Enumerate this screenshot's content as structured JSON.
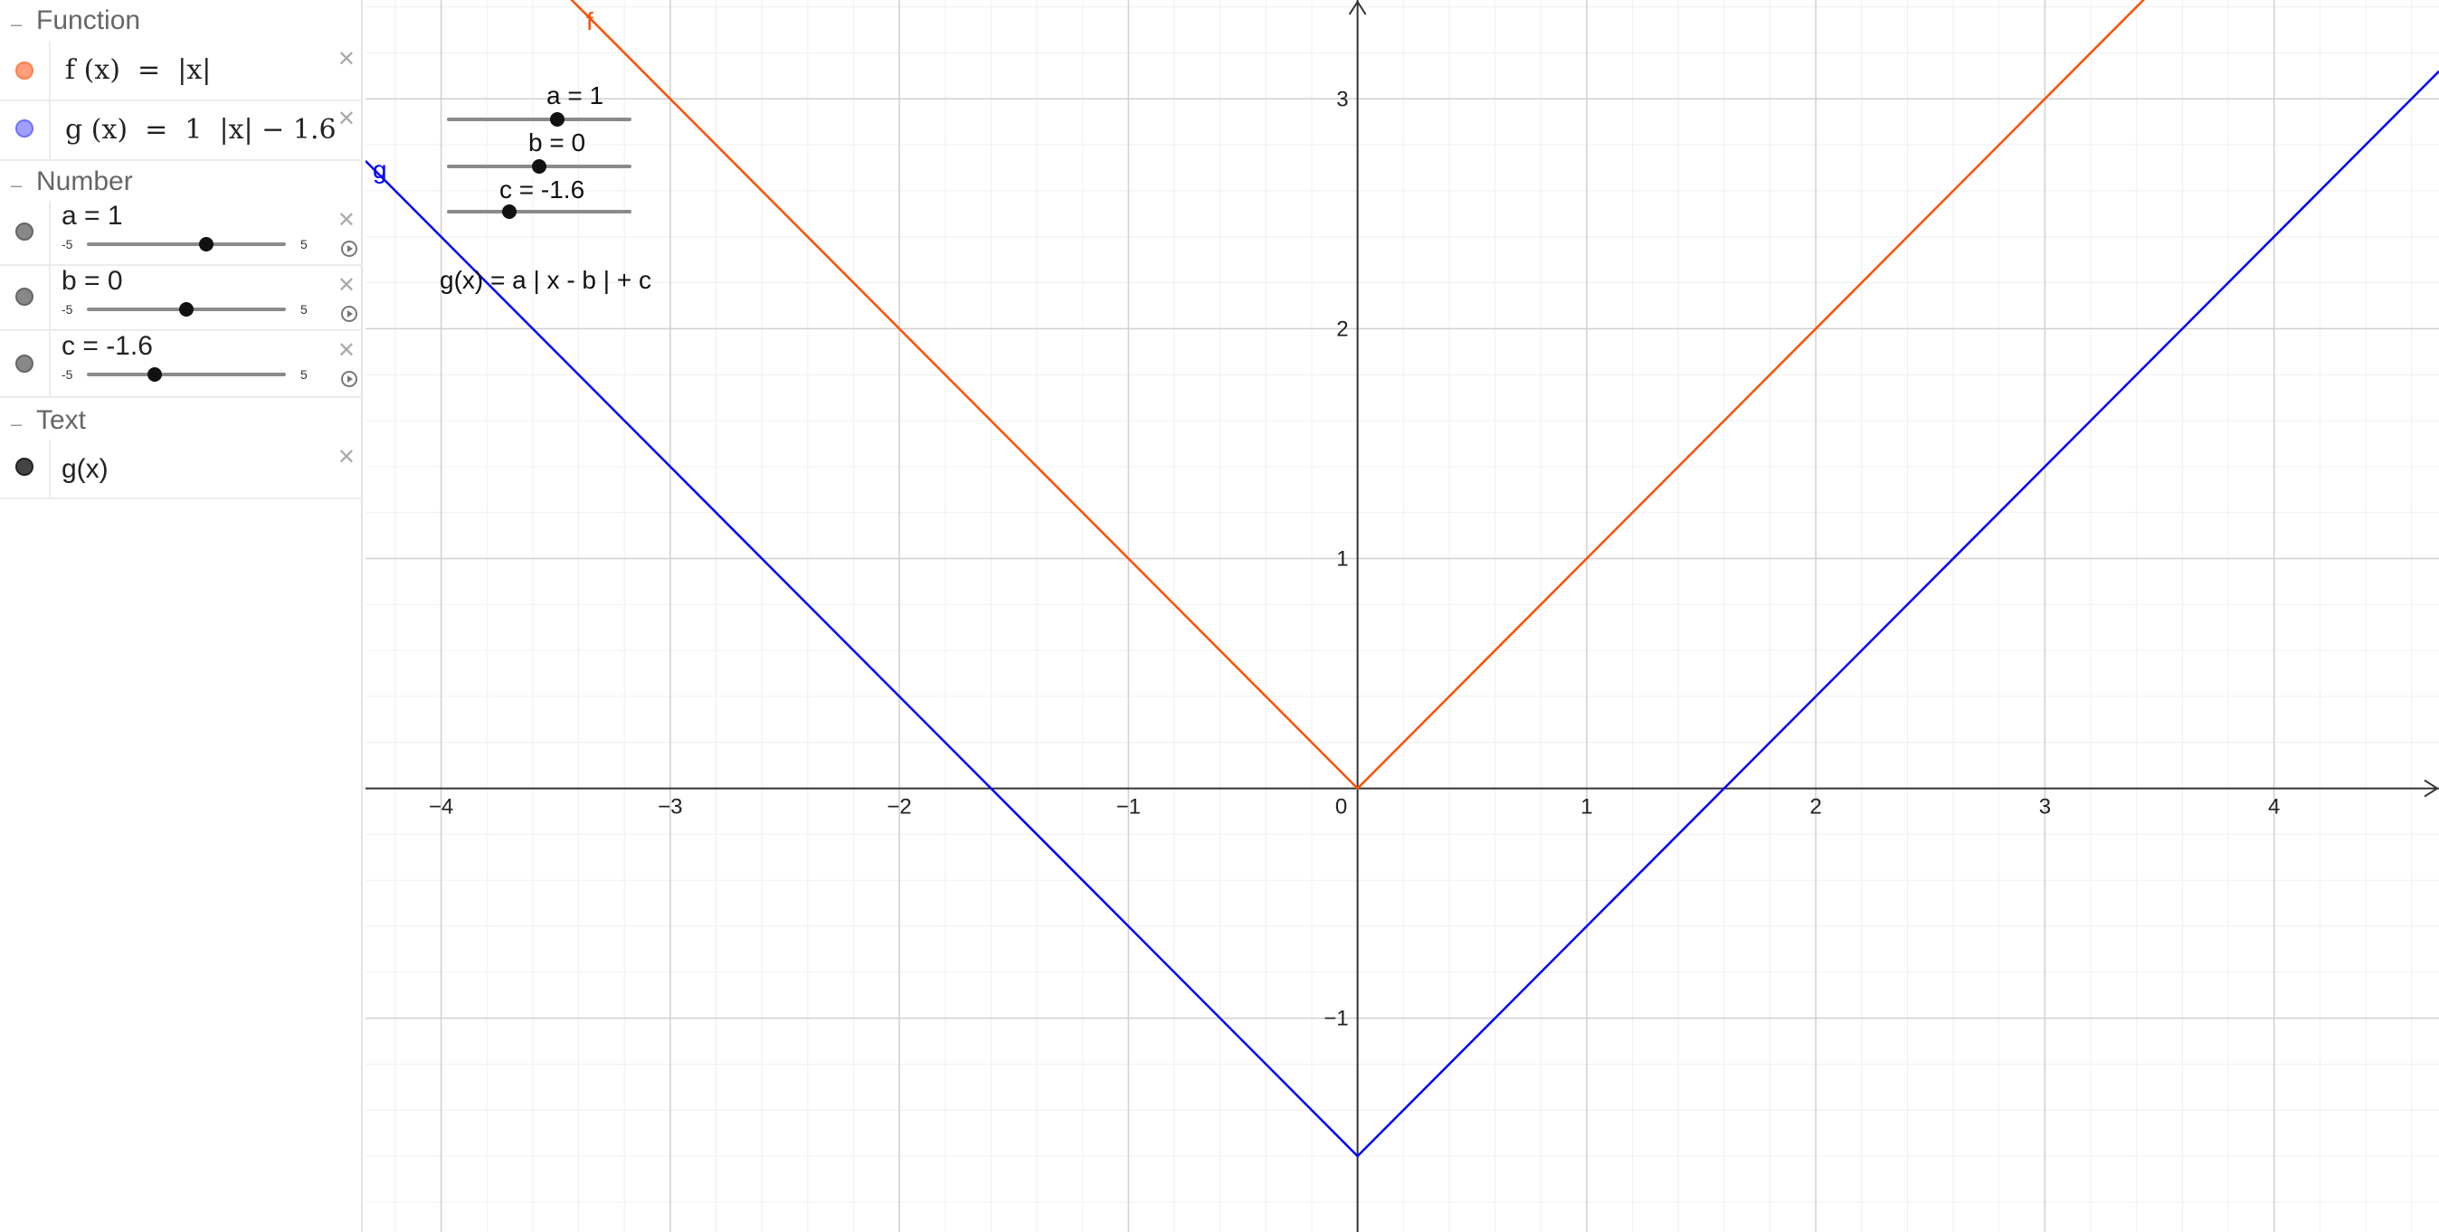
{
  "algebra": {
    "categories": {
      "function": "Function",
      "number": "Number",
      "text": "Text"
    },
    "functions": [
      {
        "expression": "f (x)  =  |x|",
        "color": "#ff8c5a"
      },
      {
        "expression": "g (x)  =  1  |x| − 1.6",
        "color": "#7f7fff"
      }
    ],
    "numbers": [
      {
        "label": "a = 1",
        "min": "-5",
        "max": "5",
        "value": 1
      },
      {
        "label": "b = 0",
        "min": "-5",
        "max": "5",
        "value": 0
      },
      {
        "label": "c = -1.6",
        "min": "-5",
        "max": "5",
        "value": -1.6
      }
    ],
    "texts": [
      {
        "label": "g(x)"
      }
    ]
  },
  "graphics": {
    "sliders": [
      {
        "label": "a = 1",
        "value": 1
      },
      {
        "label": "b = 0",
        "value": 0
      },
      {
        "label": "c = -1.6",
        "value": -1.6
      }
    ],
    "formula_text": "g(x) = a | x - b | + c",
    "curve_labels": {
      "f": "f",
      "g": "g"
    },
    "colors": {
      "f": "#ff4f00",
      "g": "#0000ff",
      "axis": "#333333",
      "grid_major": "#d0d0d0",
      "grid_minor": "#f0f0f0"
    }
  },
  "chart_data": {
    "type": "line",
    "xlim": [
      -4.33,
      4.72
    ],
    "ylim": [
      -1.93,
      3.43
    ],
    "x_ticks": [
      "−4",
      "−3",
      "−2",
      "−1",
      "0",
      "1",
      "2",
      "3",
      "4"
    ],
    "y_ticks": [
      "−1",
      "1",
      "2",
      "3"
    ],
    "grid": true,
    "series": [
      {
        "name": "f",
        "formula": "|x|",
        "points": [
          [
            -4.33,
            4.33
          ],
          [
            0,
            0
          ],
          [
            4.72,
            4.72
          ]
        ]
      },
      {
        "name": "g",
        "formula": "1|x| - 1.6",
        "points": [
          [
            -4.33,
            2.73
          ],
          [
            0,
            -1.6
          ],
          [
            4.72,
            3.12
          ]
        ]
      }
    ]
  }
}
